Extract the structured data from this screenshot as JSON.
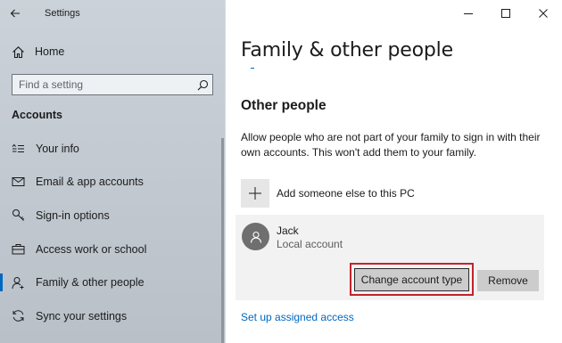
{
  "window": {
    "app_title": "Settings",
    "controls": {
      "minimize": "minimize-icon",
      "maximize": "maximize-icon",
      "close": "close-icon"
    }
  },
  "sidebar": {
    "home_label": "Home",
    "search_placeholder": "Find a setting",
    "section_title": "Accounts",
    "items": [
      {
        "label": "Your info",
        "icon": "person-card-icon",
        "active": false
      },
      {
        "label": "Email & app accounts",
        "icon": "mail-icon",
        "active": false
      },
      {
        "label": "Sign-in options",
        "icon": "key-icon",
        "active": false
      },
      {
        "label": "Access work or school",
        "icon": "briefcase-icon",
        "active": false
      },
      {
        "label": "Family & other people",
        "icon": "person-add-icon",
        "active": true
      },
      {
        "label": "Sync your settings",
        "icon": "sync-icon",
        "active": false
      }
    ]
  },
  "main": {
    "page_title": "Family & other people",
    "section_title": "Other people",
    "description": "Allow people who are not part of your family to sign in with their own accounts. This won't add them to your family.",
    "add_label": "Add someone else to this PC",
    "account": {
      "name": "Jack",
      "type": "Local account",
      "change_button": "Change account type",
      "remove_button": "Remove"
    },
    "assigned_access_link": "Set up assigned access"
  },
  "colors": {
    "accent": "#0067c0",
    "highlight_outline": "#c4232b",
    "sidebar_bg": "#c3cad2",
    "button_bg": "#cccccc"
  }
}
